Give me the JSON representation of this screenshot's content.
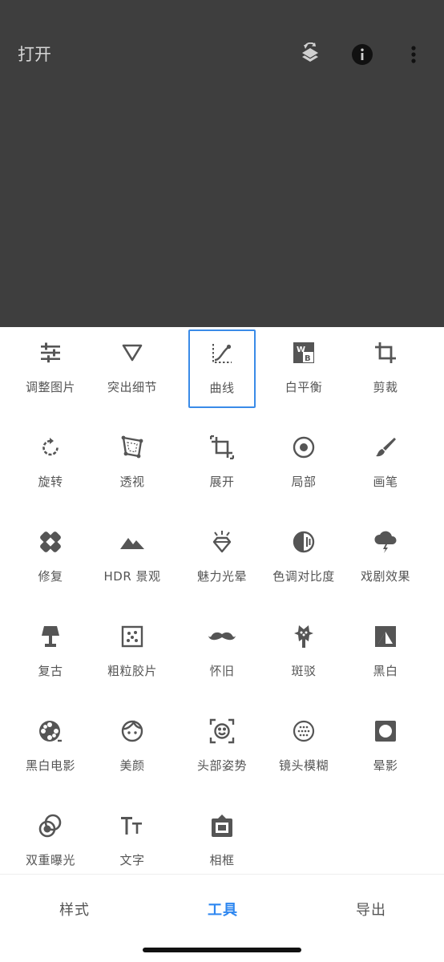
{
  "header": {
    "title": "打开"
  },
  "tools": [
    {
      "label": "调整图片",
      "icon": "tune-sliders-icon"
    },
    {
      "label": "突出细节",
      "icon": "details-triangle-icon"
    },
    {
      "label": "曲线",
      "icon": "curves-icon",
      "selected": true
    },
    {
      "label": "白平衡",
      "icon": "white-balance-icon"
    },
    {
      "label": "剪裁",
      "icon": "crop-icon"
    },
    {
      "label": "旋转",
      "icon": "rotate-icon"
    },
    {
      "label": "透视",
      "icon": "perspective-icon"
    },
    {
      "label": "展开",
      "icon": "expand-icon"
    },
    {
      "label": "局部",
      "icon": "selective-icon"
    },
    {
      "label": "画笔",
      "icon": "brush-icon"
    },
    {
      "label": "修复",
      "icon": "healing-bandage-icon"
    },
    {
      "label": "HDR 景观",
      "icon": "hdr-mountains-icon"
    },
    {
      "label": "魅力光晕",
      "icon": "glamour-glow-icon"
    },
    {
      "label": "色调对比度",
      "icon": "tonal-contrast-icon"
    },
    {
      "label": "戏剧效果",
      "icon": "drama-cloud-icon"
    },
    {
      "label": "复古",
      "icon": "vintage-lamp-icon"
    },
    {
      "label": "粗粒胶片",
      "icon": "grainy-film-icon"
    },
    {
      "label": "怀旧",
      "icon": "retrolux-mustache-icon"
    },
    {
      "label": "斑驳",
      "icon": "grunge-guitar-icon"
    },
    {
      "label": "黑白",
      "icon": "black-white-icon"
    },
    {
      "label": "黑白电影",
      "icon": "film-reel-icon"
    },
    {
      "label": "美颜",
      "icon": "face-glow-icon"
    },
    {
      "label": "头部姿势",
      "icon": "head-pose-icon"
    },
    {
      "label": "镜头模糊",
      "icon": "lens-blur-icon"
    },
    {
      "label": "晕影",
      "icon": "vignette-icon"
    },
    {
      "label": "双重曝光",
      "icon": "double-exposure-icon"
    },
    {
      "label": "文字",
      "icon": "text-icon"
    },
    {
      "label": "相框",
      "icon": "frame-icon"
    }
  ],
  "tabs": {
    "styles": "样式",
    "tools": "工具",
    "export": "导出"
  },
  "colors": {
    "accent": "#2e87f0",
    "topbar": "#3e3e3e",
    "icon": "#555555"
  }
}
